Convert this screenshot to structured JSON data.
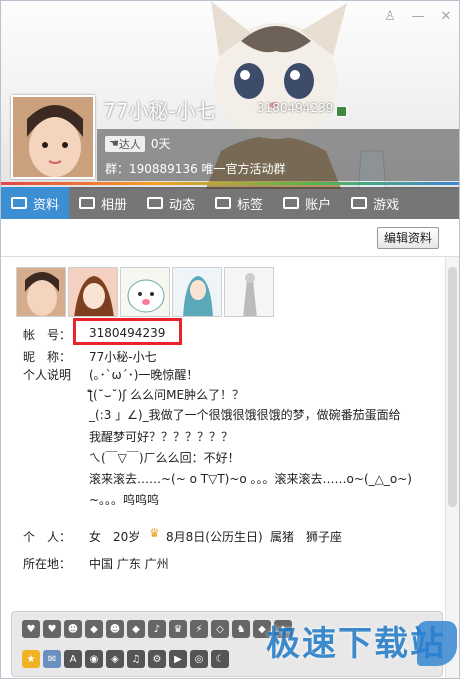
{
  "window": {
    "skin_icon": "shirt-icon",
    "min_label": "—",
    "close_label": "✕"
  },
  "profile": {
    "nickname": "77小秘-小七",
    "qq_number": "3180494239",
    "vip_label": "达人",
    "vip_days": "0天",
    "group_text": "群：190889136 唯一官方活动群"
  },
  "tabs": [
    {
      "label": "资料"
    },
    {
      "label": "相册"
    },
    {
      "label": "动态"
    },
    {
      "label": "标签"
    },
    {
      "label": "账户"
    },
    {
      "label": "游戏"
    }
  ],
  "edit_button": "编辑资料",
  "info": {
    "account_label": "帐　号：",
    "account_value": "3180494239",
    "nick_label": "昵　称：",
    "nick_value": "77小秘-小七",
    "desc_label": "个人说明",
    "desc_lines": [
      "(｡･`ω´･)一晚惊醒！",
      "ƪ(˘⌣˘)ʃ 么么问ME肿么了！？",
      "_(:3 」∠)_我做了一个很饿很饿很饿的梦，做碗番茄蛋面给",
      "我醒梦可好？？？？？？？",
      "ㄟ(￣▽￣)ㄏ么么回：不好！",
      "滚来滚去……~(~ o T▽T)~o 。。。滚来滚去……o~(_△_o~)",
      "~。。。呜呜呜"
    ],
    "person_label": "个　人：",
    "person_sex": "女",
    "person_age": "20岁",
    "person_birthday": "8月8日(公历生日)",
    "person_zodiac": "属猪",
    "person_star": "狮子座",
    "location_label": "所在地：",
    "location_value": "中国 广东 广州"
  },
  "watermark": "极速下载站",
  "accent": "#3d8fd4",
  "highlight_color": "#e9232b"
}
